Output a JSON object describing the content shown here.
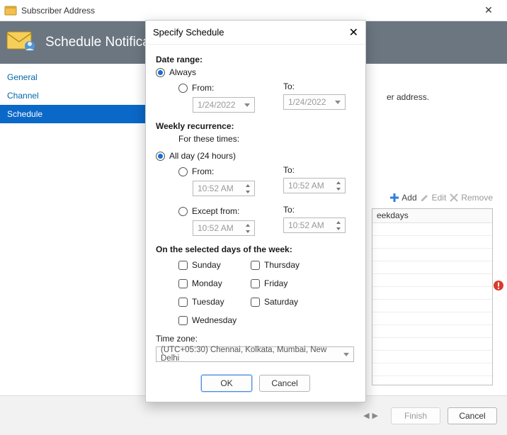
{
  "window": {
    "title": "Subscriber Address"
  },
  "banner": {
    "title": "Schedule Notificat…"
  },
  "sidebar": {
    "items": [
      {
        "label": "General",
        "selected": false
      },
      {
        "label": "Channel",
        "selected": false
      },
      {
        "label": "Schedule",
        "selected": true
      }
    ]
  },
  "main": {
    "hint_suffix": "er address.",
    "toolbar": {
      "add": "Add",
      "edit": "Edit",
      "remove": "Remove"
    },
    "list": {
      "header_fragment": "eekdays"
    }
  },
  "footer": {
    "finish": "Finish",
    "cancel": "Cancel"
  },
  "modal": {
    "title": "Specify Schedule",
    "date_range": {
      "heading": "Date range:",
      "always": "Always",
      "from": "From:",
      "to": "To:",
      "from_value": "1/24/2022",
      "to_value": "1/24/2022",
      "selected": "always"
    },
    "weekly": {
      "heading": "Weekly recurrence:",
      "sub": "For these times:",
      "all_day": "All day (24 hours)",
      "from": "From:",
      "to": "To:",
      "from_value": "10:52 AM",
      "to_value": "10:52 AM",
      "except_from": "Except from:",
      "except_to": "To:",
      "except_from_value": "10:52 AM",
      "except_to_value": "10:52 AM",
      "selected": "all_day"
    },
    "days": {
      "heading": "On the selected days of the week:",
      "sunday": "Sunday",
      "monday": "Monday",
      "tuesday": "Tuesday",
      "wednesday": "Wednesday",
      "thursday": "Thursday",
      "friday": "Friday",
      "saturday": "Saturday"
    },
    "tz": {
      "label": "Time zone:",
      "value": "(UTC+05:30) Chennai, Kolkata, Mumbai, New Delhi"
    },
    "ok": "OK",
    "cancel": "Cancel"
  }
}
